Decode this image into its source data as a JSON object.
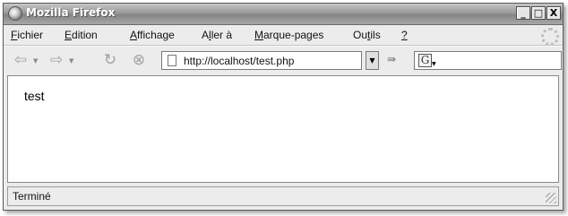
{
  "window": {
    "title": "Mozilla Firefox"
  },
  "titlebar_buttons": {
    "minimize": "_",
    "maximize": "□",
    "close": "X"
  },
  "menu": {
    "items": [
      {
        "before": "",
        "mnemonic": "F",
        "after": "ichier"
      },
      {
        "before": "",
        "mnemonic": "E",
        "after": "dition"
      },
      {
        "before": "",
        "mnemonic": "A",
        "after": "ffichage"
      },
      {
        "before": "A",
        "mnemonic": "l",
        "after": "ler à"
      },
      {
        "before": "",
        "mnemonic": "M",
        "after": "arque-pages"
      },
      {
        "before": "Ou",
        "mnemonic": "t",
        "after": "ils"
      },
      {
        "before": "",
        "mnemonic": "?",
        "after": ""
      }
    ]
  },
  "navbar": {
    "url": "http://localhost/test.php",
    "icons": [
      "back-icon",
      "forward-icon",
      "reload-icon",
      "stop-icon",
      "page-icon",
      "go-icon",
      "google-search-icon"
    ]
  },
  "content": {
    "text": "test"
  },
  "status": {
    "text": "Terminé"
  },
  "colors": {
    "titlebar": "#9a9a9a",
    "window_bg": "#ececec",
    "content_bg": "#ffffff"
  }
}
